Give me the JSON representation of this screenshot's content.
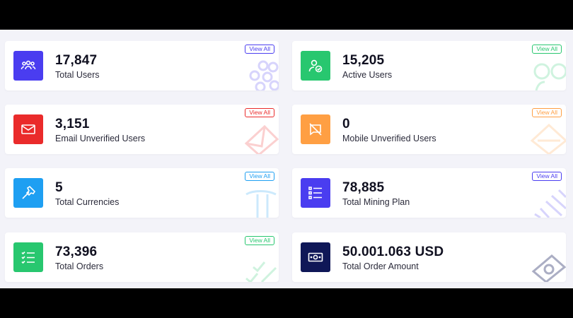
{
  "colors": {
    "page_bg": "#f3f3f9",
    "indigo": "#4a3df0",
    "green": "#28c76f",
    "red": "#ea2b2b",
    "orange": "#ff9f43",
    "blue": "#1e9ff2",
    "navy": "#0f1757"
  },
  "cards": [
    {
      "value": "17,847",
      "label": "Total Users",
      "action": "View All",
      "icon": "users-group-icon",
      "color": "#4a3df0"
    },
    {
      "value": "15,205",
      "label": "Active Users",
      "action": "View All",
      "icon": "user-check-icon",
      "color": "#28c76f"
    },
    {
      "value": "3,151",
      "label": "Email Unverified Users",
      "action": "View All",
      "icon": "envelope-icon",
      "color": "#ea2b2b"
    },
    {
      "value": "0",
      "label": "Mobile Unverified Users",
      "action": "View All",
      "icon": "message-slash-icon",
      "color": "#ff9f43"
    },
    {
      "value": "5",
      "label": "Total Currencies",
      "action": "View All",
      "icon": "hammer-icon",
      "color": "#1e9ff2"
    },
    {
      "value": "78,885",
      "label": "Total Mining Plan",
      "action": "View All",
      "icon": "list-icon",
      "color": "#4a3df0"
    },
    {
      "value": "73,396",
      "label": "Total Orders",
      "action": "View All",
      "icon": "checklist-icon",
      "color": "#28c76f"
    },
    {
      "value": "50.001.063 USD",
      "label": "Total Order Amount",
      "action": "",
      "icon": "money-bill-icon",
      "color": "#0f1757"
    }
  ]
}
